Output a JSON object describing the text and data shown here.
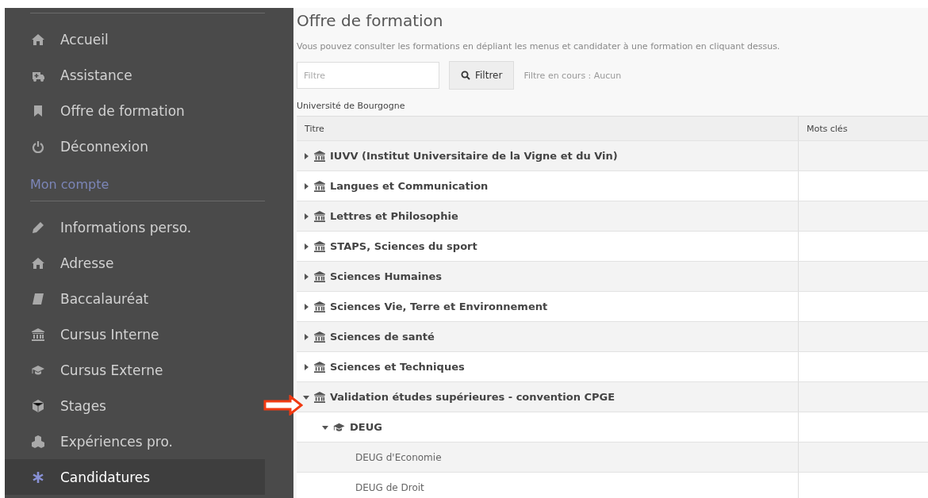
{
  "sidebar": {
    "groups": [
      {
        "items": [
          {
            "label": "Accueil",
            "selected": false
          },
          {
            "label": "Assistance",
            "selected": false
          },
          {
            "label": "Offre de formation",
            "selected": false
          },
          {
            "label": "Déconnexion",
            "selected": false
          }
        ]
      },
      {
        "heading": "Mon compte",
        "items": [
          {
            "label": "Informations perso.",
            "selected": false
          },
          {
            "label": "Adresse",
            "selected": false
          },
          {
            "label": "Baccalauréat",
            "selected": false
          },
          {
            "label": "Cursus Interne",
            "selected": false
          },
          {
            "label": "Cursus Externe",
            "selected": false
          },
          {
            "label": "Stages",
            "selected": false
          },
          {
            "label": "Expériences pro.",
            "selected": false
          },
          {
            "label": "Candidatures",
            "selected": true
          }
        ]
      }
    ]
  },
  "page": {
    "title": "Offre de formation",
    "description": "Vous pouvez consulter les formations en dépliant les menus et candidater à une formation en cliquant dessus.",
    "filter": {
      "placeholder": "Filtre",
      "button": "Filtrer",
      "status": "Filtre en cours : Aucun"
    },
    "university": "Université de Bourgogne"
  },
  "table": {
    "columns": [
      "Titre",
      "Mots clés"
    ],
    "rows": [
      {
        "title": "IUVV (Institut Universitaire de la Vigne et du Vin)",
        "kind": "faculty",
        "expanded": false
      },
      {
        "title": "Langues et Communication",
        "kind": "faculty",
        "expanded": false
      },
      {
        "title": "Lettres et Philosophie",
        "kind": "faculty",
        "expanded": false
      },
      {
        "title": "STAPS, Sciences du sport",
        "kind": "faculty",
        "expanded": false
      },
      {
        "title": "Sciences Humaines",
        "kind": "faculty",
        "expanded": false
      },
      {
        "title": "Sciences Vie, Terre et Environnement",
        "kind": "faculty",
        "expanded": false
      },
      {
        "title": "Sciences de santé",
        "kind": "faculty",
        "expanded": false
      },
      {
        "title": "Sciences et Techniques",
        "kind": "faculty",
        "expanded": false
      },
      {
        "title": "Validation études supérieures - convention CPGE",
        "kind": "faculty",
        "expanded": true,
        "children": [
          {
            "title": "DEUG",
            "kind": "degree",
            "expanded": true,
            "children": [
              {
                "title": "DEUG d'Economie",
                "kind": "program"
              },
              {
                "title": "DEUG de Droit",
                "kind": "program"
              }
            ]
          }
        ]
      }
    ]
  }
}
